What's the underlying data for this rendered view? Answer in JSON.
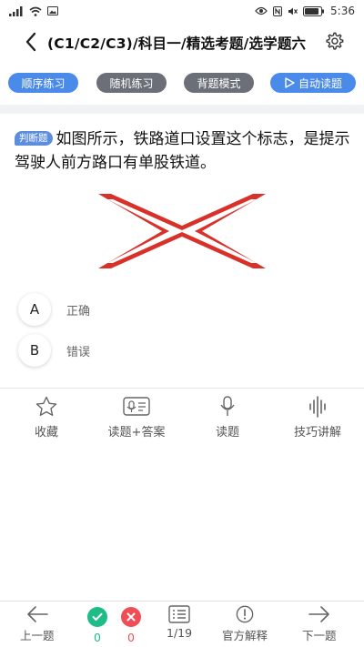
{
  "status_bar": {
    "time": "5:36"
  },
  "navbar": {
    "title": "(C1/C2/C3)/科目一/精选考题/选学题六"
  },
  "tabs": [
    {
      "label": "顺序练习",
      "style": "blue"
    },
    {
      "label": "随机练习",
      "style": "gray"
    },
    {
      "label": "背题模式",
      "style": "gray"
    },
    {
      "label": "自动读题",
      "style": "blue",
      "icon": "play-icon"
    }
  ],
  "question": {
    "type_badge": "判断题",
    "text": "如图所示，铁路道口设置这个标志，是提示驾驶人前方路口有单股铁道。"
  },
  "sign": {
    "icon": "railway-crossing-sign",
    "color": "#d9302a"
  },
  "options": [
    {
      "letter": "A",
      "text": "正确"
    },
    {
      "letter": "B",
      "text": "错误"
    }
  ],
  "actions": [
    {
      "label": "收藏",
      "icon": "star-icon"
    },
    {
      "label": "读题+答案",
      "icon": "read-answer-icon"
    },
    {
      "label": "读题",
      "icon": "microphone-icon"
    },
    {
      "label": "技巧讲解",
      "icon": "soundwave-icon"
    }
  ],
  "bottom_bar": {
    "prev_label": "上一题",
    "correct_count": "0",
    "wrong_count": "0",
    "progress": "1/19",
    "explain_label": "官方解释",
    "next_label": "下一题"
  },
  "colors": {
    "accent": "#4a8ae8",
    "correct": "#1ebc86",
    "wrong": "#ee4f57",
    "sign_red": "#d9302a"
  }
}
